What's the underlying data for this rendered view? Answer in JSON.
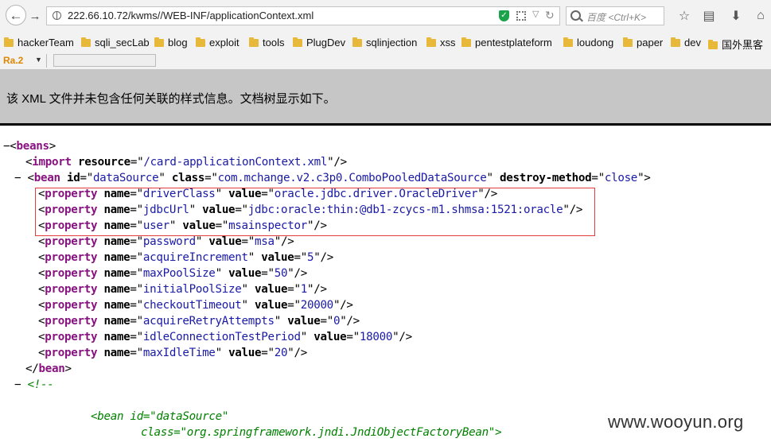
{
  "browser": {
    "url": "222.66.10.72/kwms//WEB-INF/applicationContext.xml",
    "search_placeholder": "百度 <Ctrl+K>"
  },
  "bookmarks": [
    "hackerTeam",
    "sqli_secLab",
    "blog",
    "exploit",
    "tools",
    "PlugDev",
    "sqlinjection",
    "xss",
    "pentestplateform",
    "loudong",
    "paper",
    "dev",
    "国外黑客"
  ],
  "addon": {
    "label": "Ra.2"
  },
  "info_bar": {
    "text": "该 XML 文件并未包含任何关联的样式信息。文档树显示如下。"
  },
  "xml": {
    "root": "beans",
    "import": {
      "tag": "import",
      "attr": "resource",
      "value": "/card-applicationContext.xml"
    },
    "bean": {
      "tag": "bean",
      "id": "dataSource",
      "class": "com.mchange.v2.c3p0.ComboPooledDataSource",
      "destroy_method": "close"
    },
    "properties": [
      {
        "name": "driverClass",
        "value": "oracle.jdbc.driver.OracleDriver"
      },
      {
        "name": "jdbcUrl",
        "value": "jdbc:oracle:thin:@db1-zcycs-m1.shmsa:1521:oracle"
      },
      {
        "name": "user",
        "value": "msainspector"
      },
      {
        "name": "password",
        "value": "msa"
      },
      {
        "name": "acquireIncrement",
        "value": "5"
      },
      {
        "name": "maxPoolSize",
        "value": "50"
      },
      {
        "name": "initialPoolSize",
        "value": "1"
      },
      {
        "name": "checkoutTimeout",
        "value": "20000"
      },
      {
        "name": "acquireRetryAttempts",
        "value": "0"
      },
      {
        "name": "idleConnectionTestPeriod",
        "value": "18000"
      },
      {
        "name": "maxIdleTime",
        "value": "20"
      }
    ],
    "comment_open": "<!--",
    "comment_bean_open": "<bean id=\"dataSource\"",
    "comment_bean_class": "class=\"org.springframework.jndi.JndiObjectFactoryBean\">"
  },
  "watermark": "www.wooyun.org",
  "colors": {
    "tag": "#881280",
    "value": "#1a1aa6",
    "comment": "#008000",
    "highlight_box": "#e23d3d"
  }
}
